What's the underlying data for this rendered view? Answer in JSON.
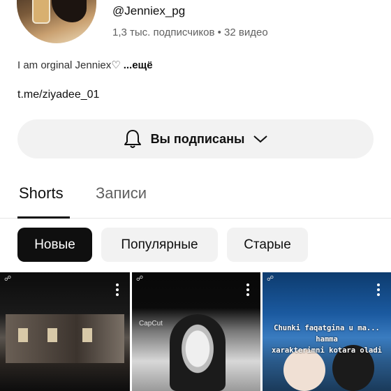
{
  "channel": {
    "handle": "@Jenniex_pg",
    "meta": "1,3 тыс. подписчиков • 32 видео",
    "bio": "I am orginal Jenniex♡",
    "bio_more": "...ещё",
    "link": "t.me/ziyadee_01"
  },
  "subscribe": {
    "label": "Вы подписаны",
    "bell_icon": "bell-icon",
    "chevron_icon": "chevron-down-icon"
  },
  "tabs": [
    {
      "label": "Shorts",
      "active": true
    },
    {
      "label": "Записи",
      "active": false
    }
  ],
  "chips": [
    {
      "label": "Новые",
      "selected": true
    },
    {
      "label": "Популярные",
      "selected": false
    },
    {
      "label": "Старые",
      "selected": false
    }
  ],
  "shorts": [
    {
      "caption": ""
    },
    {
      "caption": "CapCut"
    },
    {
      "caption_line1": "Chunki faqatgina u ma... hamma",
      "caption_line2": "xarakterimni kotara oladi"
    }
  ],
  "colors": {
    "chip_selected_bg": "#0f0f0f",
    "chip_bg": "#f2f2f2",
    "button_bg": "#f2f2f2",
    "secondary_text": "#606060"
  }
}
